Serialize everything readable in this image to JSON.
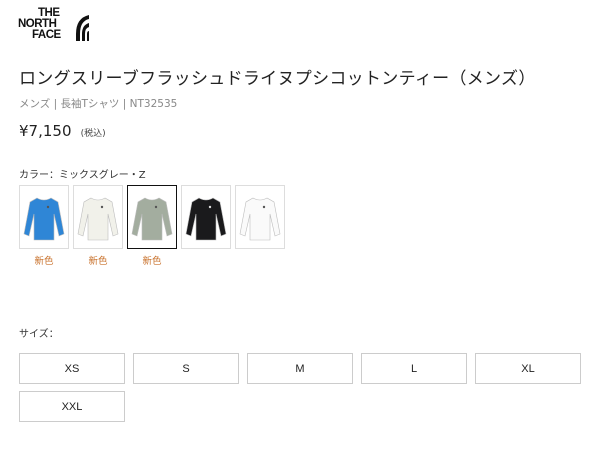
{
  "brand": {
    "logo_lines": [
      "THE",
      "NORTH",
      "FACE"
    ]
  },
  "product": {
    "title": "ロングスリーブフラッシュドライヌプシコットンティー（メンズ）",
    "subtitle": "メンズ | 長袖Tシャツ | NT32535",
    "price": "¥7,150",
    "tax_note": "(税込)"
  },
  "color": {
    "label": "カラー：ミックスグレー・Z",
    "swatches": [
      {
        "color_hex": "#2f86d6",
        "badge": "新色",
        "selected": false
      },
      {
        "color_hex": "#f1f1ea",
        "badge": "新色",
        "selected": false
      },
      {
        "color_hex": "#a3ad9f",
        "badge": "新色",
        "selected": true
      },
      {
        "color_hex": "#1a1a1c",
        "badge": "",
        "selected": false
      },
      {
        "color_hex": "#fafafa",
        "badge": "",
        "selected": false
      }
    ]
  },
  "size": {
    "label": "サイズ：",
    "options": [
      "XS",
      "S",
      "M",
      "L",
      "XL",
      "XXL"
    ]
  }
}
